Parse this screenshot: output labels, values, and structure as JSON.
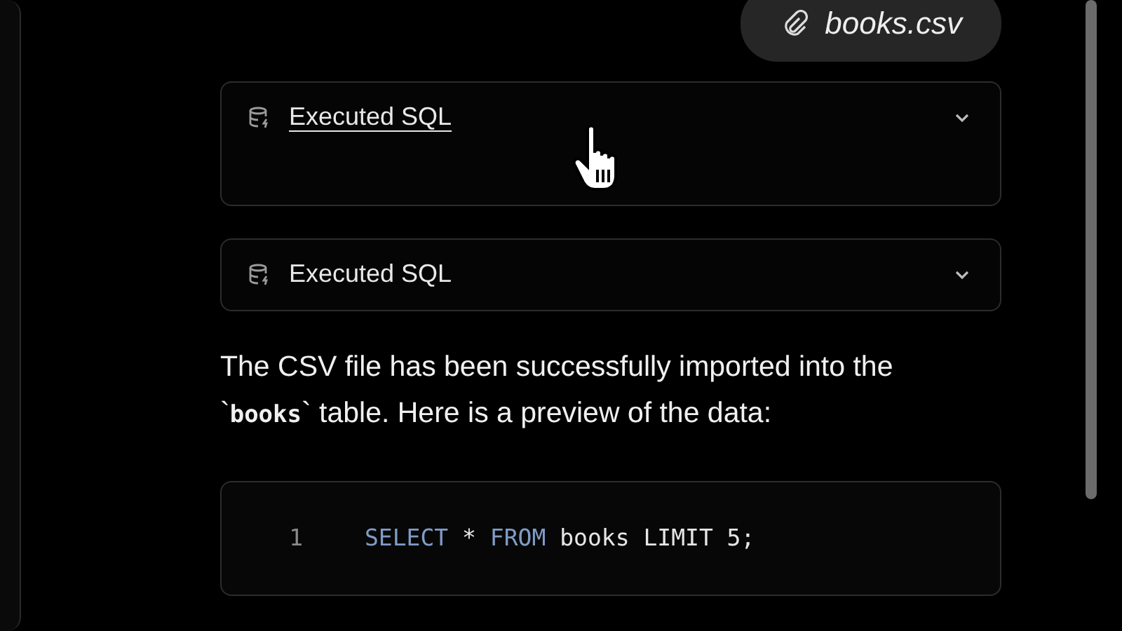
{
  "attachment": {
    "filename": "books.csv"
  },
  "tool_calls": [
    {
      "label": "Executed SQL",
      "hovered": true,
      "expanded": true
    },
    {
      "label": "Executed SQL",
      "hovered": false,
      "expanded": false
    }
  ],
  "message": "The CSV file has been successfully imported into the `**books**` table. Here is a preview of the data:",
  "code_block": {
    "lines": [
      {
        "number": "1",
        "tokens": [
          {
            "text": "SELECT",
            "kind": "keyword"
          },
          {
            "text": " * ",
            "kind": "plain"
          },
          {
            "text": "FROM",
            "kind": "keyword"
          },
          {
            "text": " books LIMIT 5;",
            "kind": "plain"
          }
        ]
      }
    ]
  }
}
